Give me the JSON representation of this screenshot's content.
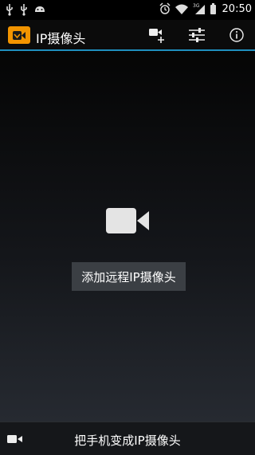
{
  "status_bar": {
    "time": "20:50",
    "left_icons": [
      "usb-icon",
      "usb-icon",
      "android-icon"
    ],
    "right_icons": [
      "alarm-icon",
      "wifi-icon",
      "signal-3g-icon",
      "battery-icon"
    ]
  },
  "action_bar": {
    "title": "IP摄像头",
    "accent_color": "#1f8fbf",
    "logo_color": "#f29400",
    "actions": [
      "add-camera-icon",
      "settings-sliders-icon",
      "info-icon"
    ]
  },
  "main": {
    "center_icon": "video-camera-icon",
    "add_remote_label": "添加远程IP摄像头"
  },
  "bottom_bar": {
    "icon": "video-camera-icon",
    "label": "把手机变成IP摄像头"
  }
}
